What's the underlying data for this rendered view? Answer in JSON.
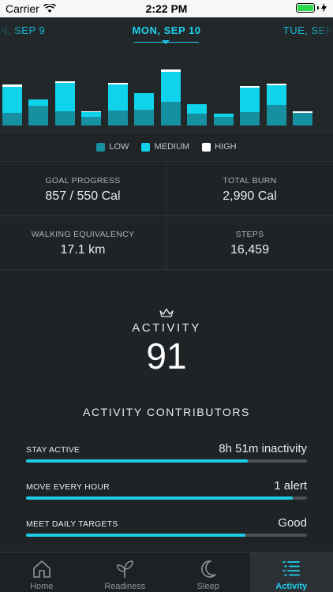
{
  "status": {
    "carrier": "Carrier",
    "time": "2:22 PM"
  },
  "dates": {
    "previous": "N, SEP 9",
    "current": "MON, SEP 10",
    "next": "TUE, SEP"
  },
  "legend": [
    {
      "label": "LOW",
      "color": "#168fa0"
    },
    {
      "label": "MEDIUM",
      "color": "#0fd3ea"
    },
    {
      "label": "HIGH",
      "color": "#ffffff"
    }
  ],
  "chart_data": {
    "type": "bar",
    "stacked": true,
    "categories": [
      "1",
      "2",
      "3",
      "4",
      "5",
      "6",
      "7",
      "8",
      "9",
      "10",
      "11",
      "12"
    ],
    "series": [
      {
        "name": "LOW",
        "color": "#168fa0",
        "values": [
          16,
          25,
          18,
          11,
          19,
          20,
          30,
          15,
          11,
          17,
          26,
          16
        ]
      },
      {
        "name": "MEDIUM",
        "color": "#0fd3ea",
        "values": [
          33,
          8,
          36,
          6,
          33,
          21,
          38,
          12,
          4,
          31,
          25,
          0
        ]
      },
      {
        "name": "HIGH",
        "color": "#ffffff",
        "values": [
          3,
          0,
          2,
          1,
          2,
          0,
          3,
          0,
          0,
          2,
          2,
          2
        ]
      }
    ],
    "ylim": [
      0,
      100
    ],
    "grid": false
  },
  "stats": {
    "goal_progress": {
      "label": "GOAL PROGRESS",
      "value": "857 / 550 Cal"
    },
    "total_burn": {
      "label": "TOTAL BURN",
      "value": "2,990 Cal"
    },
    "walking": {
      "label": "WALKING EQUIVALENCY",
      "value": "17.1 km"
    },
    "steps": {
      "label": "STEPS",
      "value": "16,459"
    }
  },
  "activity": {
    "title": "ACTIVITY",
    "score": "91",
    "contributors_title": "ACTIVITY CONTRIBUTORS"
  },
  "contributors": [
    {
      "label": "STAY ACTIVE",
      "value": "8h 51m inactivity",
      "progress": 0.79
    },
    {
      "label": "MOVE EVERY HOUR",
      "value": "1 alert",
      "progress": 0.95
    },
    {
      "label": "MEET DAILY TARGETS",
      "value": "Good",
      "progress": 0.78
    }
  ],
  "tabs": [
    {
      "label": "Home",
      "icon": "home-icon"
    },
    {
      "label": "Readiness",
      "icon": "sprout-icon"
    },
    {
      "label": "Sleep",
      "icon": "moon-icon"
    },
    {
      "label": "Activity",
      "icon": "activity-list-icon"
    }
  ]
}
